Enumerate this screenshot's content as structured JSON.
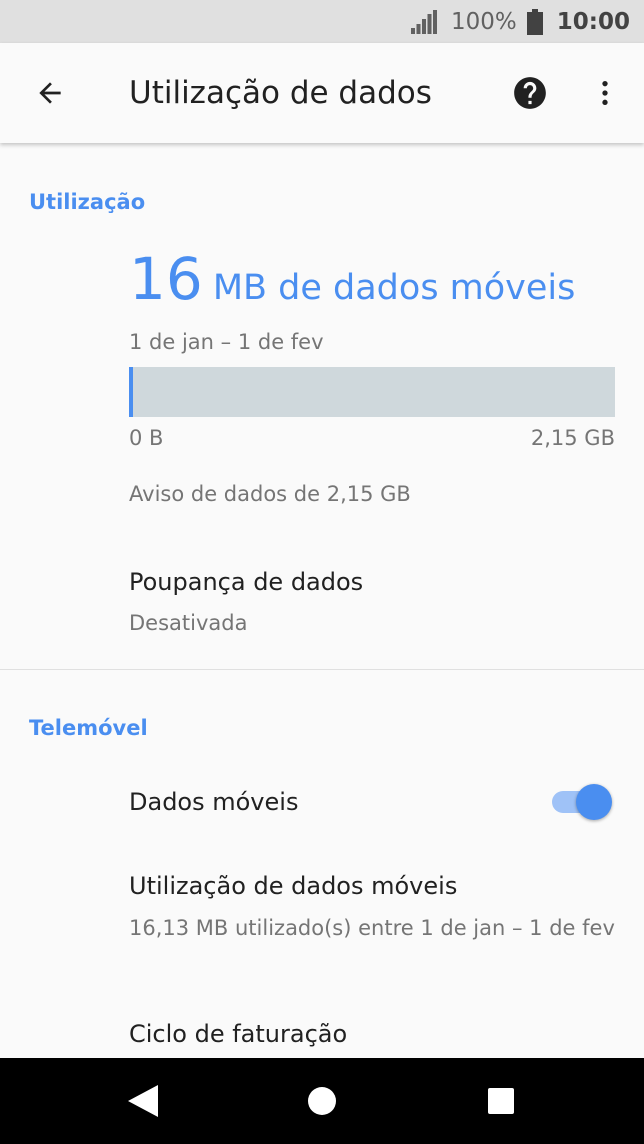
{
  "status_bar": {
    "battery_percent": "100%",
    "time": "10:00",
    "icons": [
      "signal-icon",
      "battery-icon"
    ]
  },
  "toolbar": {
    "title": "Utilização de dados",
    "icons": [
      "back-arrow-icon",
      "help-icon",
      "more-vert-icon"
    ]
  },
  "usage_section": {
    "header": "Utilização",
    "amount": "16",
    "unit": "MB de dados móveis",
    "period": "1 de jan – 1 de fev",
    "bar": {
      "min_label": "0 B",
      "max_label": "2,15 GB",
      "used_fraction": 0.0075
    },
    "warning": "Aviso de dados de 2,15 GB",
    "data_saver": {
      "title": "Poupança de dados",
      "status": "Desativada"
    }
  },
  "mobile_section": {
    "header": "Telemóvel",
    "mobile_data": {
      "label": "Dados móveis",
      "enabled": true
    },
    "mobile_usage": {
      "title": "Utilização de dados móveis",
      "description": "16,13 MB utilizado(s) entre 1 de jan – 1 de fev"
    },
    "billing_cycle": {
      "title": "Ciclo de faturação"
    }
  },
  "nav_bar": {
    "icons": [
      "nav-back-icon",
      "nav-home-icon",
      "nav-recents-icon"
    ]
  },
  "colors": {
    "accent": "#4a8ef0",
    "bar_track": "#cfd8dc",
    "status_bar": "#e0e0e0",
    "background": "#fafafa",
    "nav_bar": "#000000"
  }
}
